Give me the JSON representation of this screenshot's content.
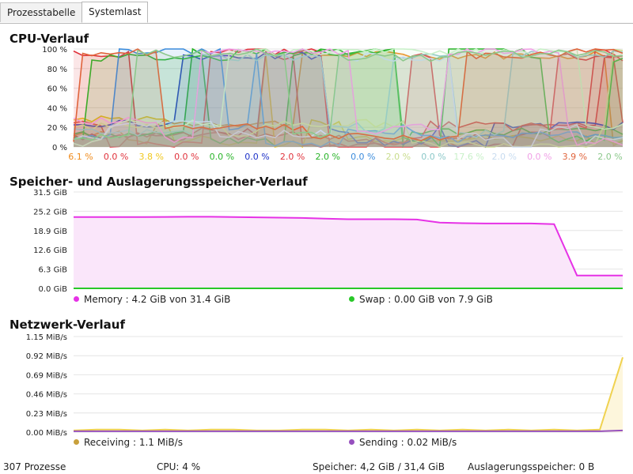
{
  "tabs": [
    {
      "label": "Prozesstabelle",
      "active": false
    },
    {
      "label": "Systemlast",
      "active": true
    }
  ],
  "cpu": {
    "title": "CPU-Verlauf",
    "y_ticks": [
      "100 %",
      "80 %",
      "60 %",
      "40 %",
      "20 %",
      "0 %"
    ],
    "cores": [
      {
        "value": "6.1 %",
        "color": "#f08c1e"
      },
      {
        "value": "0.0 %",
        "color": "#e0323c"
      },
      {
        "value": "3.8 %",
        "color": "#f0c81e"
      },
      {
        "value": "0.0 %",
        "color": "#e0323c"
      },
      {
        "value": "0.0 %",
        "color": "#28b428"
      },
      {
        "value": "0.0 %",
        "color": "#1e32c8"
      },
      {
        "value": "2.0 %",
        "color": "#e0323c"
      },
      {
        "value": "2.0 %",
        "color": "#28b428"
      },
      {
        "value": "0.0 %",
        "color": "#3c8cdc"
      },
      {
        "value": "2.0 %",
        "color": "#c8dc8c"
      },
      {
        "value": "0.0 %",
        "color": "#8cc8c8"
      },
      {
        "value": "17.6 %",
        "color": "#c8f0c8"
      },
      {
        "value": "2.0 %",
        "color": "#c8dcf0"
      },
      {
        "value": "0.0 %",
        "color": "#f0a0e6"
      },
      {
        "value": "3.9 %",
        "color": "#e0643c"
      },
      {
        "value": "2.0 %",
        "color": "#8cc88c"
      }
    ]
  },
  "memory": {
    "title": "Speicher- und Auslagerungsspeicher-Verlauf",
    "y_ticks": [
      "31.5 GiB",
      "25.2 GiB",
      "18.9 GiB",
      "12.6 GiB",
      "6.3 GiB",
      "0.0 GiB"
    ],
    "ymax": 31.5,
    "memory_label": "Memory : 4.2 GiB von 31.4 GiB",
    "swap_label": "Swap : 0.00 GiB von 7.9 GiB",
    "memory_color": "#e632e6",
    "memory_fill": "#fae6fa",
    "swap_color": "#28c828",
    "memory_series": [
      23.3,
      23.3,
      23.3,
      23.3,
      23.35,
      23.4,
      23.4,
      23.3,
      23.2,
      23.1,
      23.0,
      22.8,
      22.6,
      22.6,
      22.6,
      22.5,
      21.5,
      21.3,
      21.2,
      21.2,
      21.2,
      21.0,
      4.2,
      4.2,
      4.2
    ],
    "swap_series": [
      0,
      0,
      0,
      0,
      0,
      0,
      0,
      0,
      0,
      0,
      0,
      0,
      0,
      0,
      0,
      0,
      0,
      0,
      0,
      0,
      0,
      0,
      0,
      0,
      0
    ]
  },
  "network": {
    "title": "Netzwerk-Verlauf",
    "y_ticks": [
      "1.15 MiB/s",
      "0.92 MiB/s",
      "0.69 MiB/s",
      "0.46 MiB/s",
      "0.23 MiB/s",
      "0.00 MiB/s"
    ],
    "ymax": 1.15,
    "receiving_label": "Receiving : 1.1 MiB/s",
    "sending_label": "Sending : 0.02 MiB/s",
    "receiving_color": "#f0d250",
    "sending_color": "#9650be",
    "receiving_series": [
      0.02,
      0.03,
      0.03,
      0.02,
      0.03,
      0.02,
      0.03,
      0.03,
      0.02,
      0.02,
      0.03,
      0.03,
      0.02,
      0.03,
      0.02,
      0.03,
      0.02,
      0.03,
      0.02,
      0.03,
      0.02,
      0.03,
      0.02,
      0.03,
      0.9
    ],
    "sending_series": [
      0.01,
      0.01,
      0.01,
      0.01,
      0.01,
      0.01,
      0.01,
      0.01,
      0.01,
      0.01,
      0.01,
      0.01,
      0.01,
      0.01,
      0.01,
      0.01,
      0.01,
      0.01,
      0.01,
      0.01,
      0.01,
      0.01,
      0.01,
      0.01,
      0.02
    ]
  },
  "status": {
    "processes": "307 Prozesse",
    "cpu": "CPU: 4 %",
    "memory": "Speicher: 4,2 GiB / 31,4 GiB",
    "swap": "Auslagerungsspeicher: 0 B"
  }
}
